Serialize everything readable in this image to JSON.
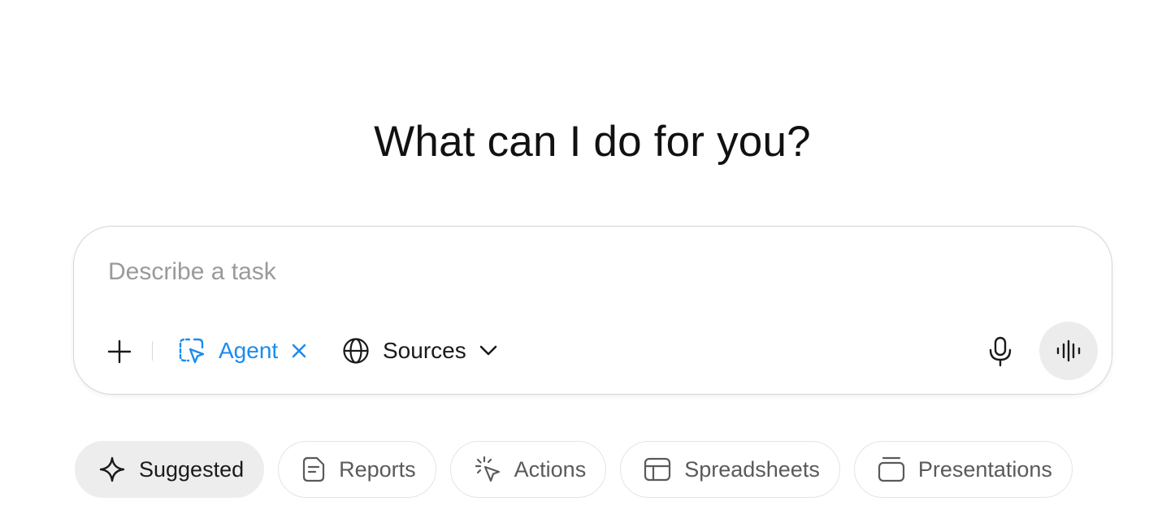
{
  "headline": "What can I do for you?",
  "composer": {
    "placeholder": "Describe a task",
    "value": "",
    "agent_label": "Agent",
    "sources_label": "Sources"
  },
  "colors": {
    "accent": "#1a8cf0",
    "text": "#1a1a1a",
    "muted": "#5a5a5a",
    "placeholder": "#9a9a9a"
  },
  "icons": {
    "add": "plus-icon",
    "agent": "agent-cursor-icon",
    "remove_agent": "close-icon",
    "sources": "globe-icon",
    "sources_menu": "chevron-down-icon",
    "mic": "microphone-icon",
    "voice": "voice-waveform-icon"
  },
  "tabs": [
    {
      "label": "Suggested",
      "icon": "sparkle-icon",
      "active": true
    },
    {
      "label": "Reports",
      "icon": "document-icon",
      "active": false
    },
    {
      "label": "Actions",
      "icon": "click-cursor-icon",
      "active": false
    },
    {
      "label": "Spreadsheets",
      "icon": "table-icon",
      "active": false
    },
    {
      "label": "Presentations",
      "icon": "slides-icon",
      "active": false
    }
  ]
}
